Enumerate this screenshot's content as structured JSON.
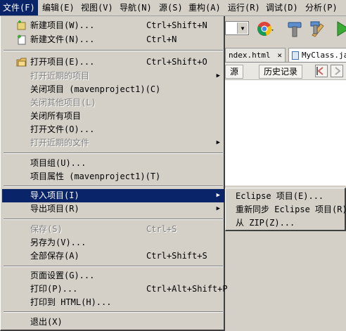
{
  "menubar": {
    "items": [
      {
        "label": "文件(F)"
      },
      {
        "label": "编辑(E)"
      },
      {
        "label": "视图(V)"
      },
      {
        "label": "导航(N)"
      },
      {
        "label": "源(S)"
      },
      {
        "label": "重构(A)"
      },
      {
        "label": "运行(R)"
      },
      {
        "label": "调试(D)"
      },
      {
        "label": "分析(P)"
      }
    ]
  },
  "editor": {
    "tabs": [
      {
        "label": "ndex.html",
        "close": "✕"
      },
      {
        "label": "MyClass.java"
      }
    ],
    "toolbar": {
      "source": "源",
      "history": "历史记录"
    }
  },
  "file_menu": {
    "items": [
      {
        "label": "新建项目(W)...",
        "shortcut": "Ctrl+Shift+N",
        "icon": "new-project-icon"
      },
      {
        "label": "新建文件(N)...",
        "shortcut": "Ctrl+N",
        "icon": "new-file-icon"
      },
      {
        "label": "打开项目(E)...",
        "shortcut": "Ctrl+Shift+O",
        "icon": "open-project-icon"
      },
      {
        "label": "打开近期的项目"
      },
      {
        "label": "关闭项目 (mavenproject1)(C)"
      },
      {
        "label": "关闭其他项目(L)"
      },
      {
        "label": "关闭所有项目"
      },
      {
        "label": "打开文件(O)..."
      },
      {
        "label": "打开近期的文件"
      },
      {
        "label": "项目组(U)..."
      },
      {
        "label": "项目属性 (mavenproject1)(T)"
      },
      {
        "label": "导入项目(I)"
      },
      {
        "label": "导出项目(R)"
      },
      {
        "label": "保存(S)",
        "shortcut": "Ctrl+S"
      },
      {
        "label": "另存为(V)..."
      },
      {
        "label": "全部保存(A)",
        "shortcut": "Ctrl+Shift+S"
      },
      {
        "label": "页面设置(G)..."
      },
      {
        "label": "打印(P)...",
        "shortcut": "Ctrl+Alt+Shift+P"
      },
      {
        "label": "打印到 HTML(H)..."
      },
      {
        "label": "退出(X)"
      }
    ]
  },
  "import_submenu": {
    "items": [
      {
        "label": "Eclipse 项目(E)..."
      },
      {
        "label": "重新同步 Eclipse 项目(R)"
      },
      {
        "label": "从 ZIP(Z)..."
      }
    ]
  },
  "colors": {
    "highlight": "#0a246a",
    "menu_bg": "#d4d0c8",
    "disabled_text": "#808080"
  }
}
